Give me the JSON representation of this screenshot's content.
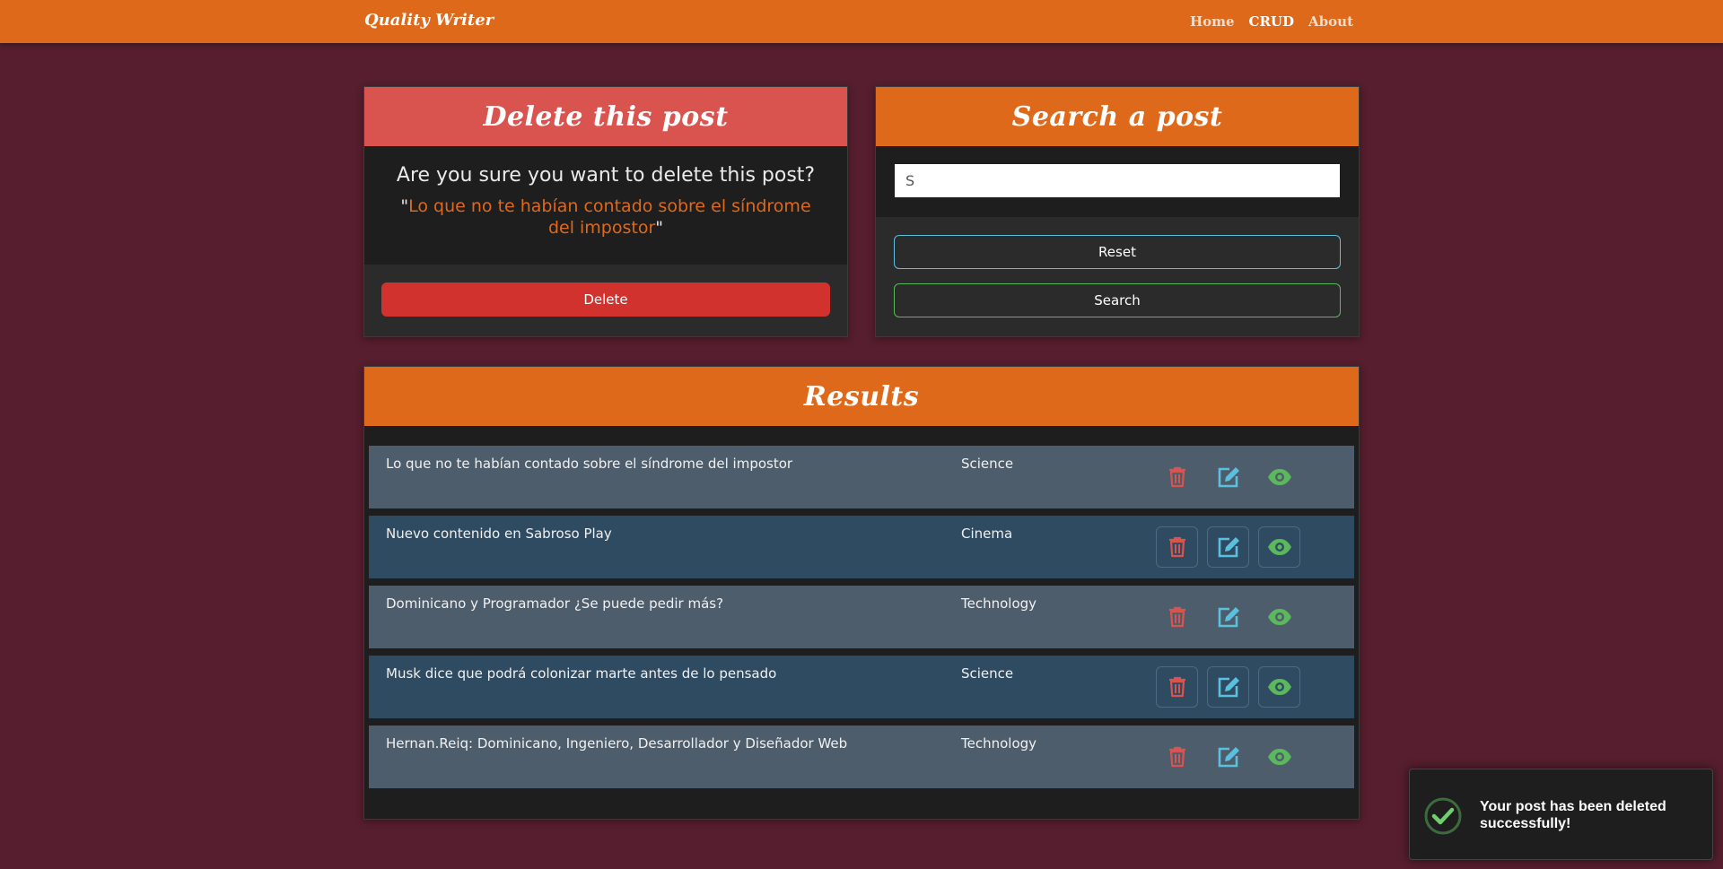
{
  "navbar": {
    "brand": "Quality Writer",
    "links": [
      "Home",
      "CRUD",
      "About"
    ]
  },
  "delete_card": {
    "header": "Delete this post",
    "question": "Are you sure you want to delete this post?",
    "post_title": "Lo que no te habían contado sobre el síndrome del impostor",
    "delete_label": "Delete"
  },
  "search_card": {
    "header": "Search a post",
    "input_value": "S",
    "reset_label": "Reset",
    "search_label": "Search"
  },
  "results": {
    "header": "Results",
    "rows": [
      {
        "title": "Lo que no te habían contado sobre el síndrome del impostor",
        "category": "Science"
      },
      {
        "title": "Nuevo contenido en Sabroso Play",
        "category": "Cinema"
      },
      {
        "title": "Dominicano y Programador ¿Se puede pedir más?",
        "category": "Technology"
      },
      {
        "title": "Musk dice que podrá colonizar marte antes de lo pensado",
        "category": "Science"
      },
      {
        "title": "Hernan.Reiq: Dominicano, Ingeniero, Desarrollador y Diseñador Web",
        "category": "Technology"
      }
    ],
    "action_icons": [
      "trash-icon",
      "edit-icon",
      "eye-icon"
    ]
  },
  "toast": {
    "message": "Your post has been deleted successfully!",
    "icon": "check-circle-icon"
  },
  "colors": {
    "background": "#561e2e",
    "accent": "#df691a",
    "danger": "#d9534f",
    "info": "#5bc0de",
    "success": "#5cb85c"
  }
}
